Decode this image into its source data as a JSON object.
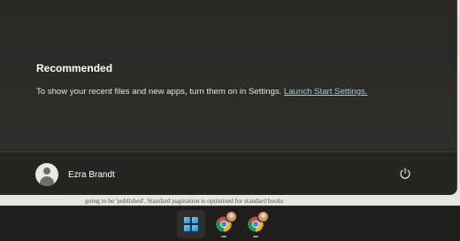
{
  "start_menu": {
    "recommended": {
      "title": "Recommended",
      "message": "To show your recent files and new apps, turn them on in Settings.",
      "link_label": "Launch Start Settings."
    },
    "footer": {
      "user_name": "Ezra Brandt",
      "power_icon": "power-icon"
    }
  },
  "background_document": {
    "visible_text": "going to be 'published'. Standard pagination is optimized for standard books"
  },
  "taskbar": {
    "items": [
      {
        "icon": "windows-start-icon",
        "active": true
      },
      {
        "icon": "chrome-icon",
        "profile_badge": true,
        "running": true
      },
      {
        "icon": "chrome-icon",
        "profile_badge": true,
        "running": true
      }
    ]
  },
  "colors": {
    "panel_bg": "#2b2a27",
    "footer_bg": "#252421",
    "link": "#8fd0e6",
    "taskbar_bg": "#1f1e1c"
  }
}
